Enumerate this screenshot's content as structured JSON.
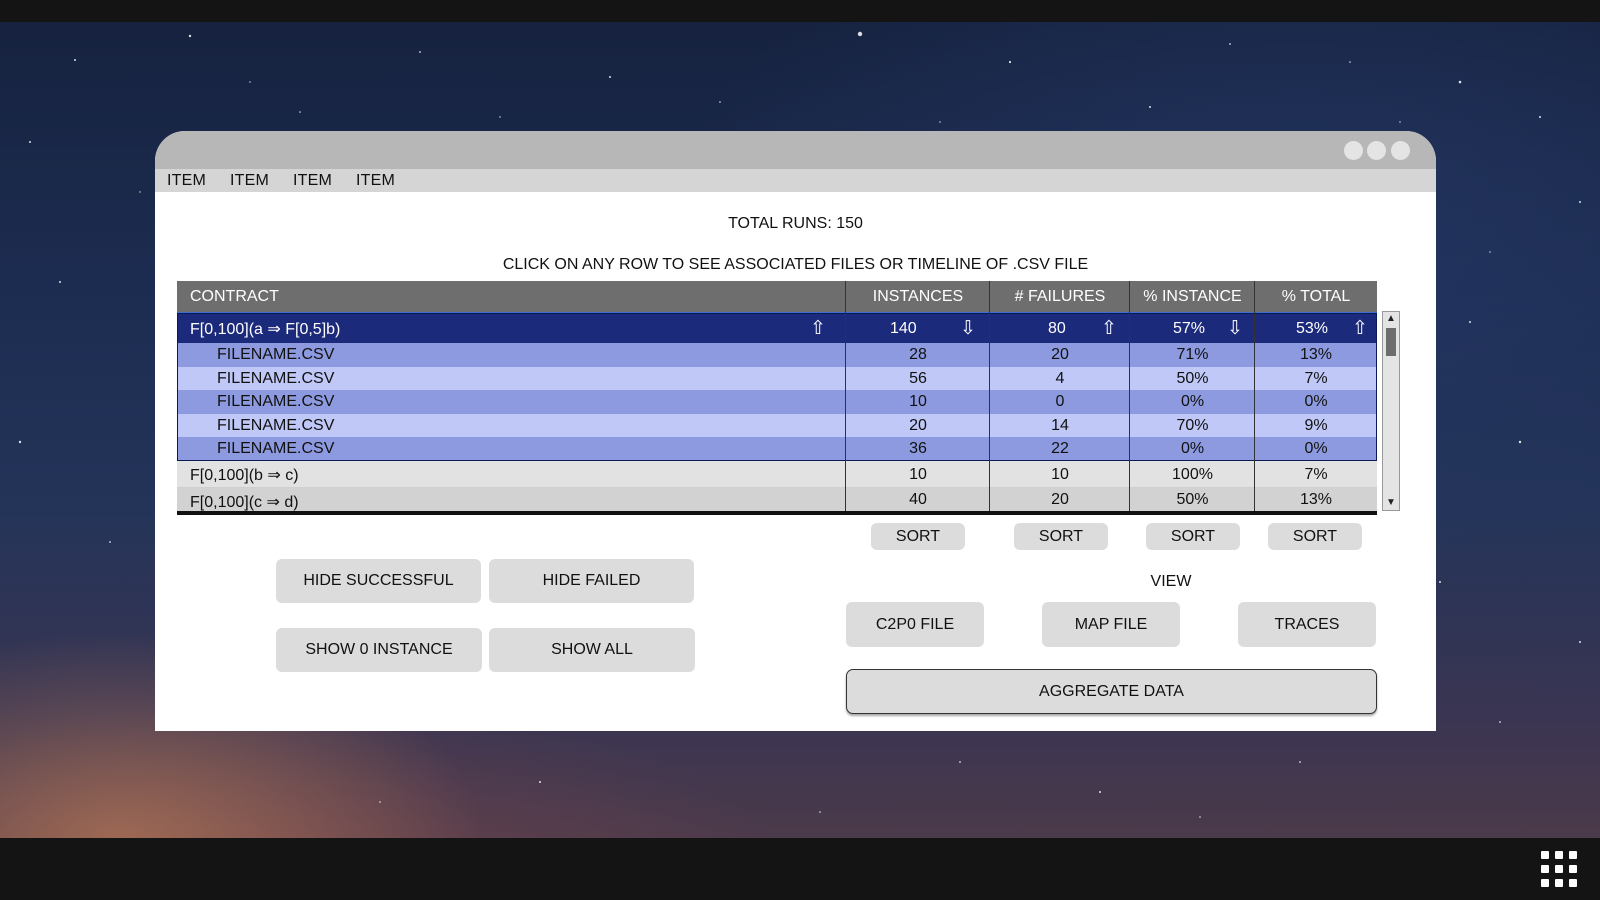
{
  "menu": [
    "ITEM",
    "ITEM",
    "ITEM",
    "ITEM"
  ],
  "summary": {
    "total_runs": "TOTAL RUNS: 150",
    "instruction": "CLICK ON ANY ROW TO SEE ASSOCIATED FILES OR TIMELINE OF .CSV FILE"
  },
  "table": {
    "headers": [
      "CONTRACT",
      "INSTANCES",
      "# FAILURES",
      "% INSTANCE",
      "% TOTAL"
    ],
    "expanded_row": {
      "contract": "F[0,100](a ⇒ F[0,5]b)",
      "instances": "140",
      "failures": "80",
      "pct_instance": "57%",
      "pct_total": "53%"
    },
    "file_rows": [
      {
        "name": "FILENAME.CSV",
        "instances": "28",
        "failures": "20",
        "pct_instance": "71%",
        "pct_total": "13%"
      },
      {
        "name": "FILENAME.CSV",
        "instances": "56",
        "failures": "4",
        "pct_instance": "50%",
        "pct_total": "7%"
      },
      {
        "name": "FILENAME.CSV",
        "instances": "10",
        "failures": "0",
        "pct_instance": "0%",
        "pct_total": "0%"
      },
      {
        "name": "FILENAME.CSV",
        "instances": "20",
        "failures": "14",
        "pct_instance": "70%",
        "pct_total": "9%"
      },
      {
        "name": "FILENAME.CSV",
        "instances": "36",
        "failures": "22",
        "pct_instance": "0%",
        "pct_total": "0%"
      }
    ],
    "other_rows": [
      {
        "contract": "F[0,100](b ⇒ c)",
        "instances": "10",
        "failures": "10",
        "pct_instance": "100%",
        "pct_total": "7%"
      },
      {
        "contract": "F[0,100](c ⇒ d)",
        "instances": "40",
        "failures": "20",
        "pct_instance": "50%",
        "pct_total": "13%"
      }
    ],
    "sort_arrows": {
      "contract": "up",
      "instances": "down",
      "failures": "up",
      "pct_instance": "down",
      "pct_total": "up"
    },
    "glyphs": {
      "up": "⇧",
      "down": "⇩",
      "scroll_up": "▲",
      "scroll_down": "▼"
    }
  },
  "sort_buttons": [
    "SORT",
    "SORT",
    "SORT",
    "SORT"
  ],
  "filters": {
    "hide_successful": "HIDE SUCCESSFUL",
    "hide_failed": "HIDE FAILED",
    "show_zero_instance": "SHOW 0 INSTANCE",
    "show_all": "SHOW ALL"
  },
  "view": {
    "label": "VIEW",
    "c2po_file": "C2P0 FILE",
    "map_file": "MAP FILE",
    "traces": "TRACES",
    "aggregate_data": "AGGREGATE DATA"
  },
  "colors": {
    "header_bg": "#6e6e6e",
    "expanded_row_bg": "#1c2a7c",
    "file_row_dark": "#8d9ae0",
    "file_row_light": "#bfc8f7",
    "other_row_bg": "#e2e2e2"
  },
  "icons": [
    "window-dot-icon",
    "sort-up-arrow-icon",
    "sort-down-arrow-icon",
    "scroll-up-icon",
    "scroll-down-icon",
    "app-grid-icon"
  ]
}
